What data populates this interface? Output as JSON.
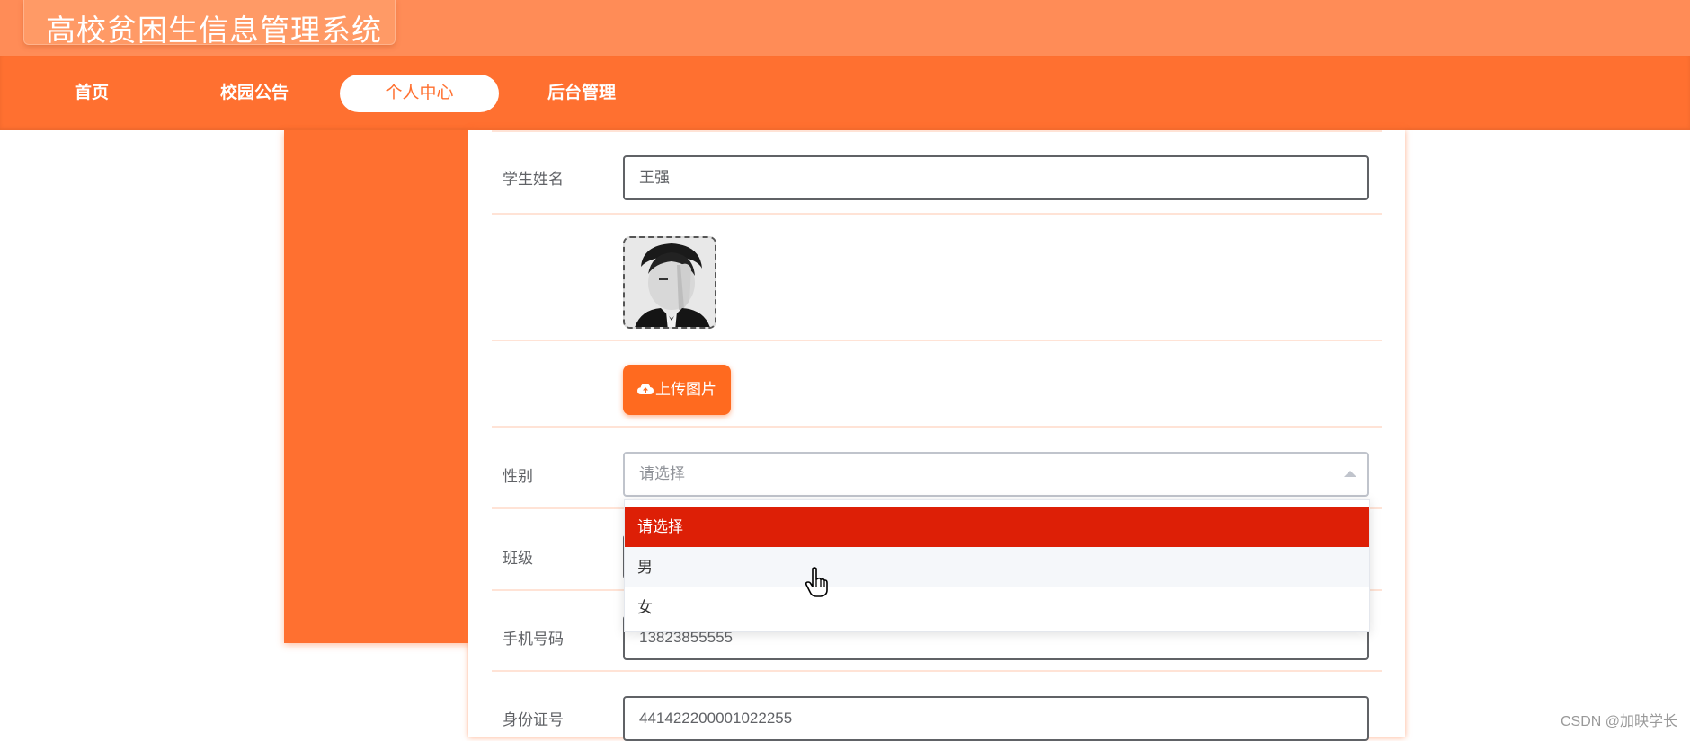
{
  "app": {
    "title": "高校贫困生信息管理系统"
  },
  "nav": {
    "items": [
      {
        "label": "首页"
      },
      {
        "label": "校园公告"
      },
      {
        "label": "个人中心"
      },
      {
        "label": "后台管理"
      }
    ],
    "active": "个人中心"
  },
  "form": {
    "student_name_label": "学生姓名",
    "student_name_value": "王强",
    "upload_label": "上传图片",
    "gender_label": "性别",
    "gender_placeholder": "请选择",
    "class_label": "班级",
    "phone_label": "手机号码",
    "phone_value": "13823855555",
    "id_label": "身份证号",
    "id_value": "441422200001022255"
  },
  "gender_dropdown": {
    "options": [
      "请选择",
      "男",
      "女"
    ],
    "selected": "请选择",
    "hovered": "男"
  },
  "icons": [
    "cloud-upload-icon",
    "caret-up-icon",
    "hand-cursor-icon"
  ],
  "colors": {
    "primary": "#ff7030",
    "topbar": "#ff8c57",
    "selected_option": "#dd1f06"
  },
  "watermark": "CSDN @加映学长"
}
